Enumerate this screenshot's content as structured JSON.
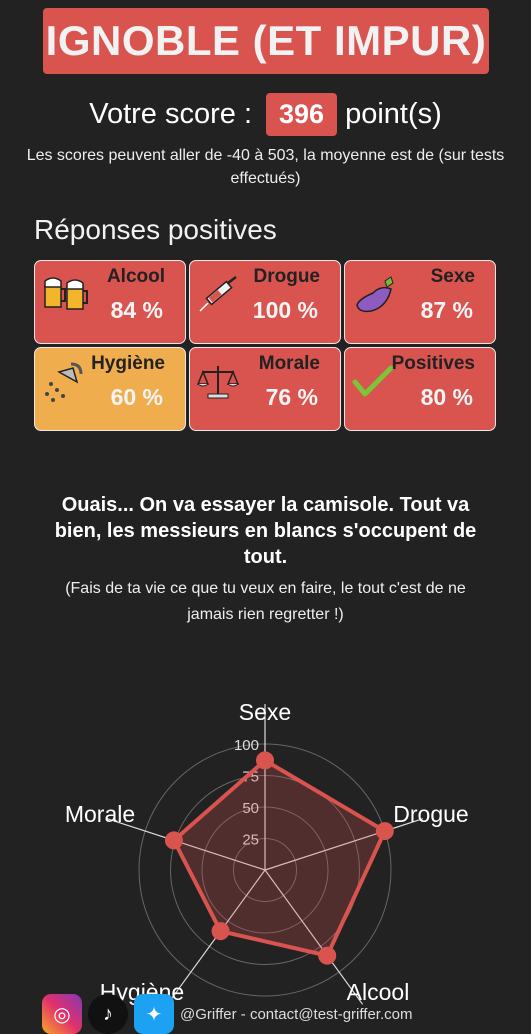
{
  "header": {
    "title": "IGNOBLE (ET IMPUR)"
  },
  "score": {
    "label": "Votre score :",
    "value": "396",
    "unit": "point(s)"
  },
  "note": "Les scores peuvent aller de -40 à 503, la moyenne est de (sur tests effectués)",
  "section_title": "Réponses positives",
  "categories": [
    {
      "name": "Alcool",
      "percent": "84 %",
      "icon": "beer-mugs-icon",
      "color": "#d9534f"
    },
    {
      "name": "Drogue",
      "percent": "100 %",
      "icon": "syringe-icon",
      "color": "#d9534f"
    },
    {
      "name": "Sexe",
      "percent": "87 %",
      "icon": "eggplant-icon",
      "color": "#d9534f"
    },
    {
      "name": "Hygiène",
      "percent": "60 %",
      "icon": "shower-icon",
      "color": "#f0ad4e"
    },
    {
      "name": "Morale",
      "percent": "76 %",
      "icon": "scales-icon",
      "color": "#d9534f"
    },
    {
      "name": "Positives",
      "percent": "80 %",
      "icon": "check-icon",
      "color": "#d9534f"
    }
  ],
  "comment": "Ouais... On va essayer la camisole. Tout va bien, les messieurs en blancs s'occupent de tout.",
  "advice": "(Fais de ta vie ce que tu veux en faire, le tout c'est de ne jamais rien regretter !)",
  "chart_data": {
    "type": "radar",
    "axes": [
      "Sexe",
      "Drogue",
      "Alcool",
      "Hygiène",
      "Morale"
    ],
    "values": [
      87,
      100,
      84,
      60,
      76
    ],
    "range": [
      0,
      100
    ],
    "ticks": [
      "25",
      "50",
      "75",
      "100"
    ],
    "color": "#d9534f"
  },
  "footer": {
    "text": "@Griffer - contact@test-griffer.com",
    "icons": [
      "instagram-icon",
      "tiktok-icon",
      "twitter-icon"
    ]
  }
}
